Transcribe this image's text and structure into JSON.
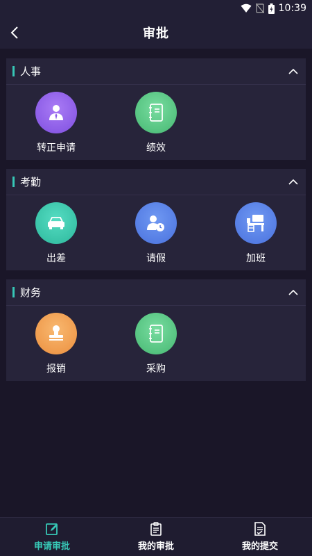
{
  "status_bar": {
    "time": "10:39"
  },
  "header": {
    "title": "审批"
  },
  "sections": [
    {
      "title": "人事",
      "items": [
        {
          "label": "转正申请",
          "icon": "person-tie-icon",
          "color": "#9b6cf0"
        },
        {
          "label": "绩效",
          "icon": "notebook-icon",
          "color": "#5fce8a"
        }
      ]
    },
    {
      "title": "考勤",
      "items": [
        {
          "label": "出差",
          "icon": "car-icon",
          "color": "#3fd0b6"
        },
        {
          "label": "请假",
          "icon": "user-clock-icon",
          "color": "#5b86ec"
        },
        {
          "label": "加班",
          "icon": "desk-icon",
          "color": "#5b86ec"
        }
      ]
    },
    {
      "title": "财务",
      "items": [
        {
          "label": "报销",
          "icon": "stamp-icon",
          "color": "#f5a45a"
        },
        {
          "label": "采购",
          "icon": "notebook-icon",
          "color": "#5fce8a"
        }
      ]
    }
  ],
  "tabs": [
    {
      "label": "申请审批",
      "icon": "edit-icon",
      "active": true
    },
    {
      "label": "我的审批",
      "icon": "clipboard-icon",
      "active": false
    },
    {
      "label": "我的提交",
      "icon": "document-icon",
      "active": false
    }
  ],
  "colors": {
    "accent": "#37c7b6",
    "background": "#1a1628",
    "card": "#27243a"
  }
}
